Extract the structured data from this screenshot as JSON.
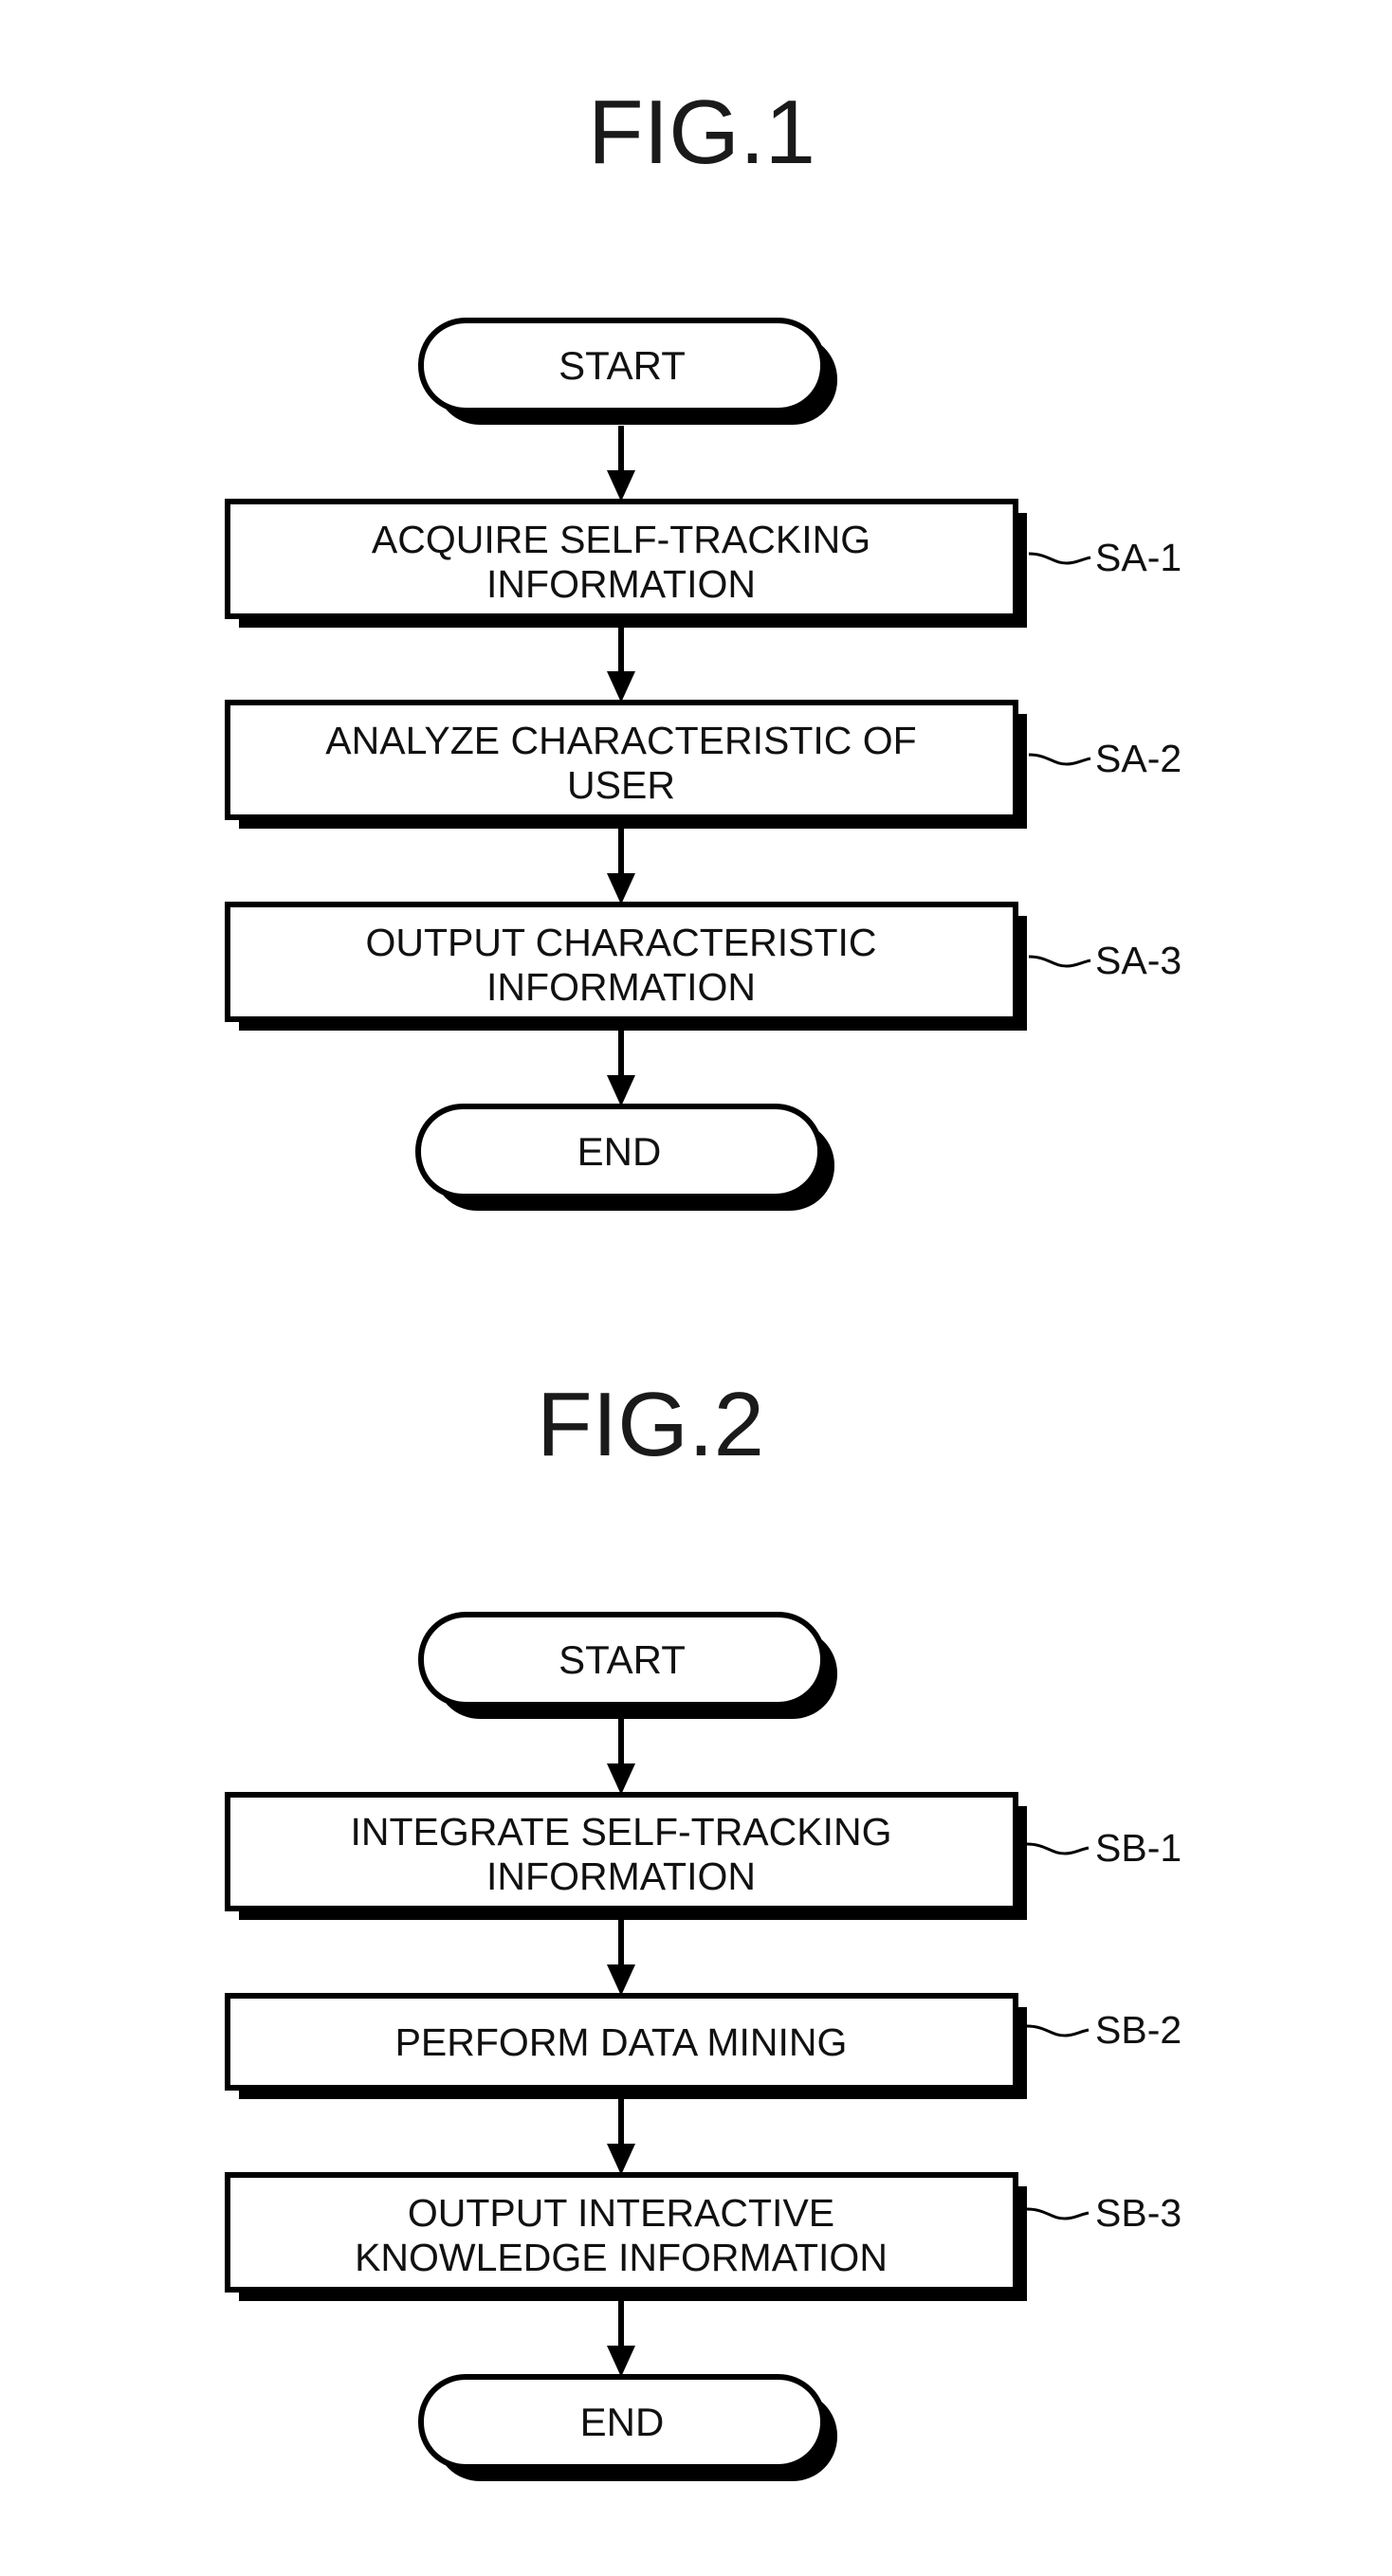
{
  "figures": [
    {
      "title": "FIG.1",
      "start_label": "START",
      "end_label": "END",
      "steps": [
        {
          "ref": "SA-1",
          "lines": [
            "ACQUIRE SELF-TRACKING",
            "INFORMATION"
          ]
        },
        {
          "ref": "SA-2",
          "lines": [
            "ANALYZE CHARACTERISTIC OF",
            "USER"
          ]
        },
        {
          "ref": "SA-3",
          "lines": [
            "OUTPUT CHARACTERISTIC",
            "INFORMATION"
          ]
        }
      ]
    },
    {
      "title": "FIG.2",
      "start_label": "START",
      "end_label": "END",
      "steps": [
        {
          "ref": "SB-1",
          "lines": [
            "INTEGRATE SELF-TRACKING",
            "INFORMATION"
          ]
        },
        {
          "ref": "SB-2",
          "lines": [
            "PERFORM DATA MINING"
          ]
        },
        {
          "ref": "SB-3",
          "lines": [
            "OUTPUT INTERACTIVE",
            "KNOWLEDGE INFORMATION"
          ]
        }
      ]
    }
  ],
  "colors": {
    "ink": "#000000",
    "background": "#ffffff"
  }
}
